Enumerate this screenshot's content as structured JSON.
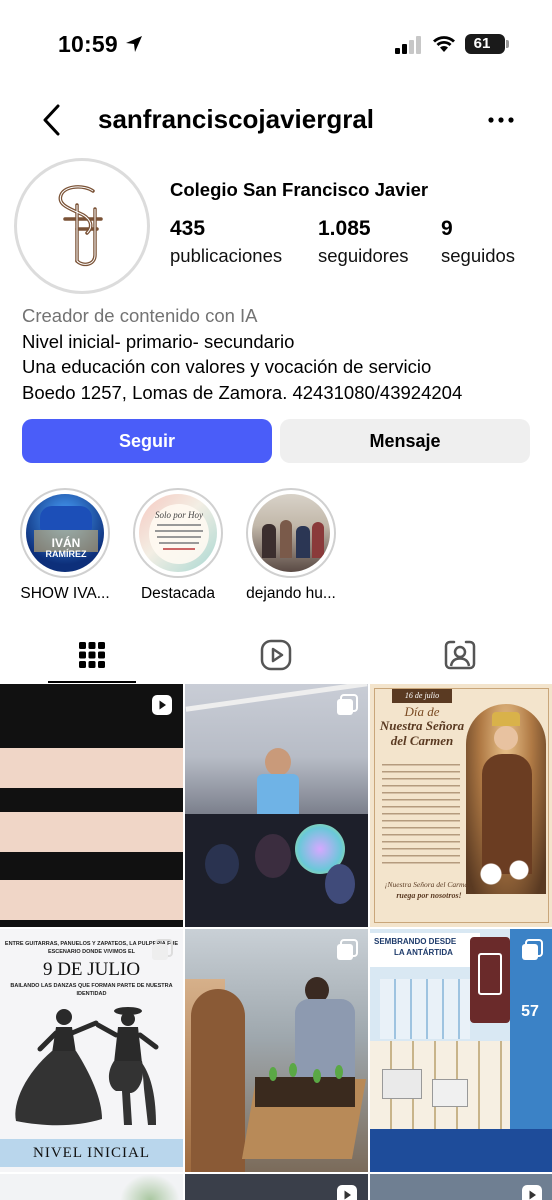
{
  "status_bar": {
    "time": "10:59",
    "battery": "61",
    "battery_fraction": 0.61
  },
  "header": {
    "username": "sanfranciscojaviergral"
  },
  "profile": {
    "display_name": "Colegio San Francisco Javier",
    "stats": [
      {
        "number": "435",
        "label": "publicaciones"
      },
      {
        "number": "1.085",
        "label": "seguidores"
      },
      {
        "number": "9",
        "label": "seguidos"
      }
    ],
    "bio": {
      "category": "Creador de contenido con IA",
      "lines": [
        "Nivel inicial- primario- secundario",
        "Una educación con valores y vocación de servicio",
        "Boedo 1257, Lomas de Zamora. 42431080/43924204"
      ]
    }
  },
  "actions": {
    "follow": "Seguir",
    "message": "Mensaje"
  },
  "highlights": [
    {
      "label": "SHOW IVA...",
      "thumb_text": [
        "IVÁN",
        "RAMÍREZ"
      ]
    },
    {
      "label": "Destacada",
      "thumb_text": [
        "Solo por Hoy"
      ]
    },
    {
      "label": "dejando hu..."
    }
  ],
  "tabs": [
    "grid-icon",
    "reels-icon",
    "tagged-icon"
  ],
  "posts": [
    {
      "type": "reel"
    },
    {
      "type": "carousel"
    },
    {
      "type": "image",
      "text": [
        "16 de julio",
        "Día de",
        "Nuestra Señora",
        "del Carmen",
        "¡Nuestra Señora del Carmen,",
        "ruega por nosotros!"
      ]
    },
    {
      "type": "carousel",
      "text": [
        "ENTRE GUITARRAS, PAÑUELOS Y ZAPATEOS, LA PULPERÍA FUE",
        "ESCENARIO DONDE VIVIMOS EL",
        "9 DE JULIO",
        "BAILANDO LAS DANZAS QUE FORMAN PARTE DE NUESTRA",
        "IDENTIDAD",
        "NIVEL INICIAL"
      ]
    },
    {
      "type": "carousel"
    },
    {
      "type": "carousel",
      "text": [
        "SEMBRANDO DESDE",
        "LA ANTÁRTIDA",
        "57"
      ]
    }
  ],
  "colors": {
    "follow_button": "#4a5df9",
    "message_button": "#efefef",
    "category_text": "#737373"
  }
}
